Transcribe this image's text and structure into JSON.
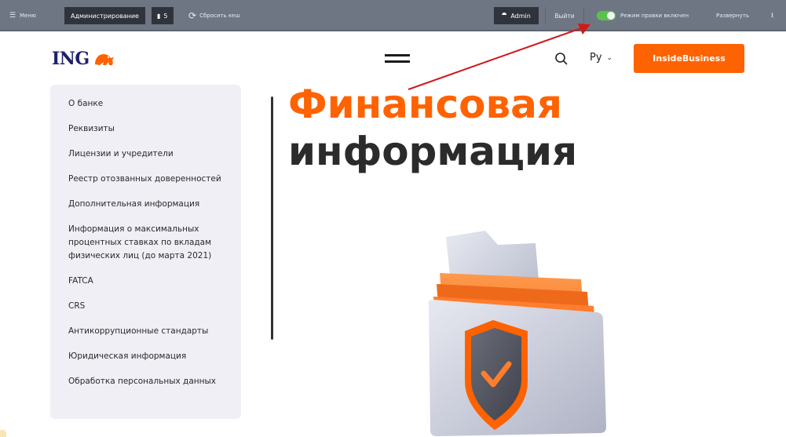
{
  "admin_bar": {
    "menu_label": "Меню",
    "admin_tab": "Администрирование",
    "count": "5",
    "reset_cache": "Сбросить кеш",
    "user": "Admin",
    "logout": "Выйти",
    "edit_mode": "Режим правки включен",
    "expand": "Развернуть"
  },
  "header": {
    "logo": "ING",
    "language": "Ру",
    "cta_button": "InsideBusiness"
  },
  "sidebar": {
    "items": [
      "О банке",
      "Реквизиты",
      "Лицензии и учредители",
      "Реестр отозванных доверенностей",
      "Дополнительная информация",
      "Информация о максимальных процентных ставках по вкладам физических лиц (до марта 2021)",
      "FATCA",
      "CRS",
      "Антикоррупционные стандарты",
      "Юридическая информация",
      "Обработка персональных данных"
    ]
  },
  "main": {
    "title_line1": "Финансовая",
    "title_line2": "информация"
  },
  "colors": {
    "brand_orange": "#ff6200",
    "brand_navy": "#1f1f6e",
    "admin_bar": "#6f7683",
    "sidebar_bg": "#efeff5",
    "toggle_on": "#59c14d",
    "annotation_arrow": "#d01a1a"
  },
  "icons": {
    "menu": "hamburger-icon",
    "count": "notebook-icon",
    "reset": "refresh-icon",
    "user": "user-icon",
    "search": "search-icon",
    "lang": "chevron-down-icon",
    "logo": "lion-icon",
    "illustration": "shield-folder-icon"
  }
}
